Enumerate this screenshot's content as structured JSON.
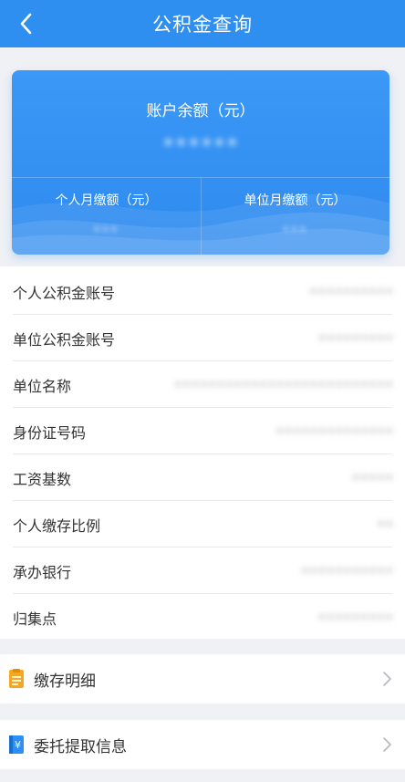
{
  "header": {
    "title": "公积金查询",
    "back_icon": "chevron-left-icon"
  },
  "balance_card": {
    "balance_label": "账户余额（元）",
    "balance_value": "••••••",
    "personal_monthly_label": "个人月缴额（元）",
    "personal_monthly_value": "•••",
    "unit_monthly_label": "单位月缴额（元）",
    "unit_monthly_value": "•••"
  },
  "info_rows": [
    {
      "label": "个人公积金账号",
      "value": "••••••••••"
    },
    {
      "label": "单位公积金账号",
      "value": "•••••••••"
    },
    {
      "label": "单位名称",
      "value": "••••••••••••••••••••••••••"
    },
    {
      "label": "身份证号码",
      "value": "••••••••••••••"
    },
    {
      "label": "工资基数",
      "value": "•••••"
    },
    {
      "label": "个人缴存比例",
      "value": "••"
    },
    {
      "label": "承办银行",
      "value": "•••••••••••"
    },
    {
      "label": "归集点",
      "value": "•••••••••"
    }
  ],
  "actions": [
    {
      "label": "缴存明细",
      "icon": "document-icon",
      "icon_color": "#f5a623"
    },
    {
      "label": "委托提取信息",
      "icon": "yuan-card-icon",
      "icon_color": "#2f8ff0"
    }
  ],
  "colors": {
    "header_bg": "#2f8ff0",
    "card_bg": "#3b98f6",
    "page_bg": "#eff1f5"
  }
}
